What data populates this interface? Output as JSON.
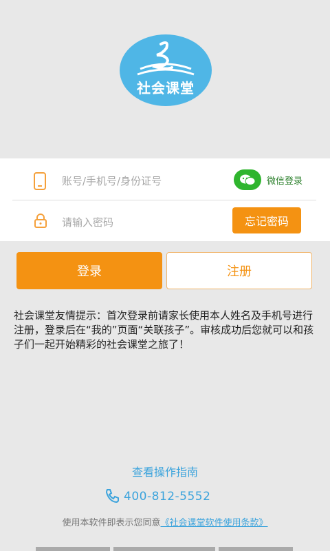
{
  "logo": {
    "text": "社会课堂"
  },
  "login": {
    "account_placeholder": "账号/手机号/身份证号",
    "password_placeholder": "请输入密码",
    "wechat_label": "微信登录",
    "forgot_label": "忘记密码"
  },
  "buttons": {
    "login_label": "登录",
    "register_label": "注册"
  },
  "notice": {
    "text": "社会课堂友情提示：首次登录前请家长使用本人姓名及手机号进行注册，登录后在“我的”页面“关联孩子”。审核成功后您就可以和孩子们一起开始精彩的社会课堂之旅了！"
  },
  "footer": {
    "guide_link": "查看操作指南",
    "phone": "400-812-5552",
    "terms_prefix": "使用本软件即表示您同意",
    "terms_link": "《社会课堂软件使用条款》"
  },
  "colors": {
    "accent_orange": "#f49212",
    "link_blue": "#3ba3dc",
    "wechat_green": "#2fb52e",
    "logo_blue": "#4fb6e6"
  },
  "icons": [
    "phone-device-icon",
    "lock-icon",
    "wechat-icon",
    "telephone-icon"
  ]
}
